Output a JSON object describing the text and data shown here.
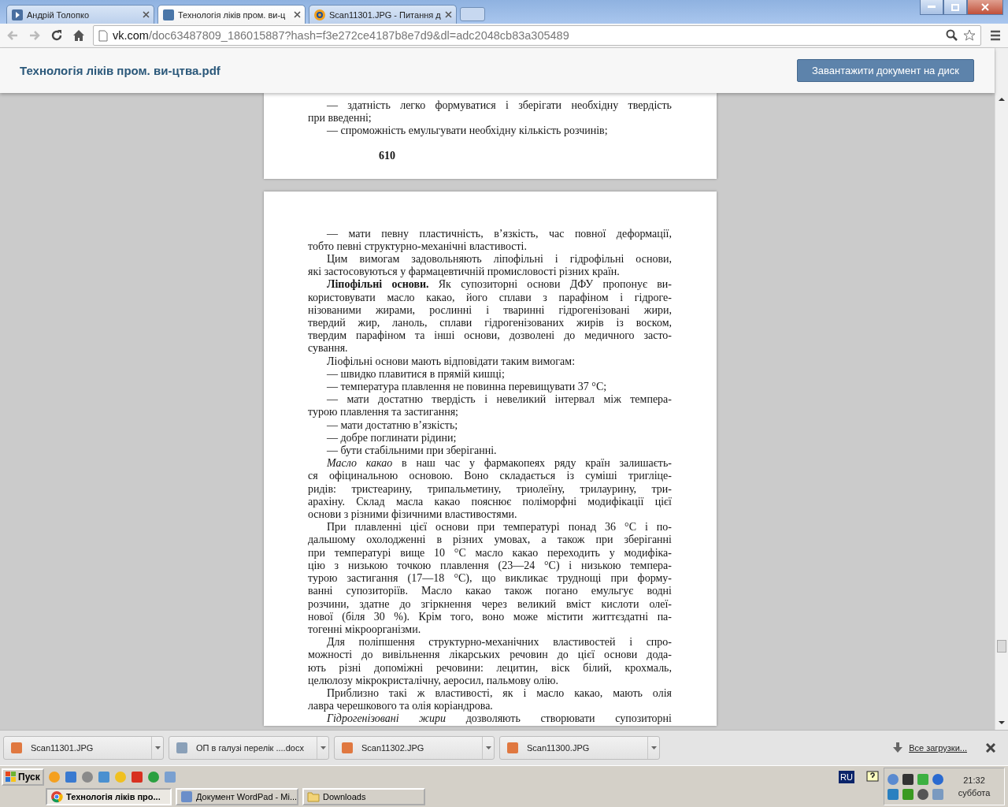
{
  "browser": {
    "tabs": [
      {
        "title": "Андрій Толопко",
        "selected": false
      },
      {
        "title": "Технологія ліків пром. ви-ц",
        "selected": true
      },
      {
        "title": "Scan11301.JPG - Питання д",
        "selected": false
      }
    ],
    "url": {
      "host": "vk.com",
      "path": "/doc63487809_186015887?hash=f3e272ce4187b8e7d9&dl=adc2048cb83a305489"
    }
  },
  "header": {
    "title": "Технологія ліків пром. ви-цтва.pdf",
    "button": "Завантажити документ на диск"
  },
  "document": {
    "pages": [
      {
        "lines": [
          {
            "kind": "start",
            "text": "— здатність легко формуватися і зберігати необхідну твердість"
          },
          {
            "kind": "end",
            "text": "при введенні;"
          },
          {
            "kind": "solo",
            "text": "— спроможність емульгувати необхідну кількість розчинів;"
          }
        ],
        "page_number": "610"
      },
      {
        "lines": [
          {
            "kind": "start",
            "text": "— мати певну пластичність, в’язкість, час повної деформації,"
          },
          {
            "kind": "end",
            "text": "тобто певні структурно-механічні властивості."
          },
          {
            "kind": "start",
            "text": "Цим вимогам задовольняють ліпофільні і гідрофільні основи,"
          },
          {
            "kind": "end",
            "text": "які застосовуються у фармацевтичній промисловості різних країн."
          },
          {
            "kind": "start",
            "text": "**Ліпофільні основи.** Як супозиторні основи ДФУ пропонує ви-"
          },
          {
            "kind": "cont",
            "text": "користовувати масло какао, його сплави з парафіном і гідроге-"
          },
          {
            "kind": "cont",
            "text": "нізованими жирами, рослинні і тваринні гідрогенізовані жири,"
          },
          {
            "kind": "cont",
            "text": "твердий жир, ланоль, сплави гідрогенізованих жирів із воском,"
          },
          {
            "kind": "cont",
            "text": "твердим парафіном та інші основи, дозволені до медичного засто-"
          },
          {
            "kind": "end",
            "text": "сування."
          },
          {
            "kind": "solo",
            "text": "Ліофільні основи мають відповідати таким вимогам:"
          },
          {
            "kind": "solo",
            "text": "— швидко плавитися в прямій кишці;"
          },
          {
            "kind": "solo",
            "text": "— температура плавлення не повинна перевищувати 37 °C;"
          },
          {
            "kind": "start",
            "text": "— мати достатню твердість і невеликий інтервал між темпера-"
          },
          {
            "kind": "end",
            "text": "турою плавлення та застигання;"
          },
          {
            "kind": "solo",
            "text": "— мати достатню в’язкість;"
          },
          {
            "kind": "solo",
            "text": "— добре поглинати рідини;"
          },
          {
            "kind": "solo",
            "text": "— бути стабільними при зберіганні."
          },
          {
            "kind": "start",
            "text": "*Масло какао* в наш час у фармакопеях ряду країн залишаєть-"
          },
          {
            "kind": "cont",
            "text": "ся офіцинальною основою. Воно складається із суміші тригліце-"
          },
          {
            "kind": "cont",
            "text": "ридів: тристеарину, трипальметину, триолеїну, трилаурину, три-"
          },
          {
            "kind": "cont",
            "text": "арахіну. Склад масла какао пояснює поліморфні модифікації цієї"
          },
          {
            "kind": "end",
            "text": "основи з різними фізичними властивостями."
          },
          {
            "kind": "start",
            "text": "При плавленні цієї основи при температурі понад 36 °C і по-"
          },
          {
            "kind": "cont",
            "text": "дальшому охолодженні в різних умовах, а також при зберіганні"
          },
          {
            "kind": "cont",
            "text": "при температурі вище 10 °C масло какао переходить у модифіка-"
          },
          {
            "kind": "cont",
            "text": "цію з низькою точкою плавлення (23—24 °C) і низькою темпера-"
          },
          {
            "kind": "cont",
            "text": "турою застигання (17—18 °C), що викликає труднощі при форму-"
          },
          {
            "kind": "cont",
            "text": "ванні супозиторіїв. Масло какао також погано емульгує водні"
          },
          {
            "kind": "cont",
            "text": "розчини, здатне до згіркнення через великий вміст кислоти олеї-"
          },
          {
            "kind": "cont",
            "text": "нової (біля 30 %). Крім того, воно може містити життєздатні па-"
          },
          {
            "kind": "end",
            "text": "тогенні мікроорганізми."
          },
          {
            "kind": "start",
            "text": "Для поліпшення структурно-механічних властивостей і спро-"
          },
          {
            "kind": "cont",
            "text": "можності до вивільнення лікарських речовин до цієї основи дода-"
          },
          {
            "kind": "cont",
            "text": "ють різні допоміжні речовини: лецитин, віск білий, крохмаль,"
          },
          {
            "kind": "end",
            "text": "целюлозу мікрокристалічну, аеросил, пальмову олію."
          },
          {
            "kind": "start",
            "text": "Приблизно такі ж властивості, як і масло какао, мають олія"
          },
          {
            "kind": "end",
            "text": "лавра черешкового та олія коріандрова."
          },
          {
            "kind": "start",
            "text": "*Гідрогенізовані жири* дозволяють створювати супозиторні"
          }
        ]
      }
    ]
  },
  "downloads": {
    "items": [
      {
        "name": "Scan11301.JPG",
        "kind": "image"
      },
      {
        "name": "ОП в галузі перелік ....docx",
        "kind": "doc"
      },
      {
        "name": "Scan11302.JPG",
        "kind": "image"
      },
      {
        "name": "Scan11300.JPG",
        "kind": "image"
      }
    ],
    "all_link": "Все загрузки..."
  },
  "taskbar": {
    "start": "Пуск",
    "tasks": [
      {
        "label": "Технологія ліків про...",
        "selected": true
      },
      {
        "label": "Документ WordPad - Mi...",
        "selected": false
      },
      {
        "label": "Downloads",
        "selected": false
      }
    ],
    "language": "RU",
    "clock": {
      "time": "21:32",
      "day": "суббота"
    }
  }
}
